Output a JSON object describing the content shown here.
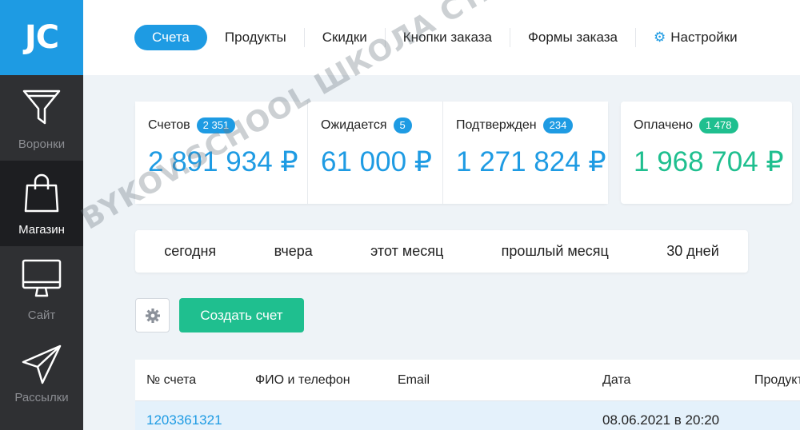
{
  "logo": "JC",
  "sidebar": {
    "items": [
      {
        "label": "Воронки",
        "icon": "funnel-icon"
      },
      {
        "label": "Магазин",
        "icon": "shopping-bag-icon"
      },
      {
        "label": "Сайт",
        "icon": "monitor-icon"
      },
      {
        "label": "Рассылки",
        "icon": "paper-plane-icon"
      }
    ]
  },
  "topnav": {
    "tabs": [
      "Счета",
      "Продукты",
      "Скидки",
      "Кнопки заказа",
      "Формы заказа"
    ],
    "settings": "Настройки"
  },
  "stats": [
    {
      "label": "Счетов",
      "count": "2 351",
      "value": "2 891 934 ₽"
    },
    {
      "label": "Ожидается",
      "count": "5",
      "value": "61 000 ₽"
    },
    {
      "label": "Подтвержден",
      "count": "234",
      "value": "1 271 824 ₽"
    },
    {
      "label": "Оплачено",
      "count": "1 478",
      "value": "1 968 704 ₽"
    }
  ],
  "periods": [
    "сегодня",
    "вчера",
    "этот месяц",
    "прошлый месяц",
    "30 дней"
  ],
  "actions": {
    "create": "Создать счет"
  },
  "table": {
    "headers": [
      "№ счета",
      "ФИО и телефон",
      "Email",
      "Дата",
      "Продукт"
    ],
    "rows": [
      {
        "id": "1203361321",
        "date": "08.06.2021 в 20:20"
      }
    ]
  },
  "watermark": "BYKOV.SCHOOL  ШКОЛА СТАСА БЫКОВА  СДЕЛАЙ ВСЁ САМ!",
  "colors": {
    "accent": "#1e9be3",
    "success": "#1fbf8f",
    "sidebar": "#2f3033"
  }
}
